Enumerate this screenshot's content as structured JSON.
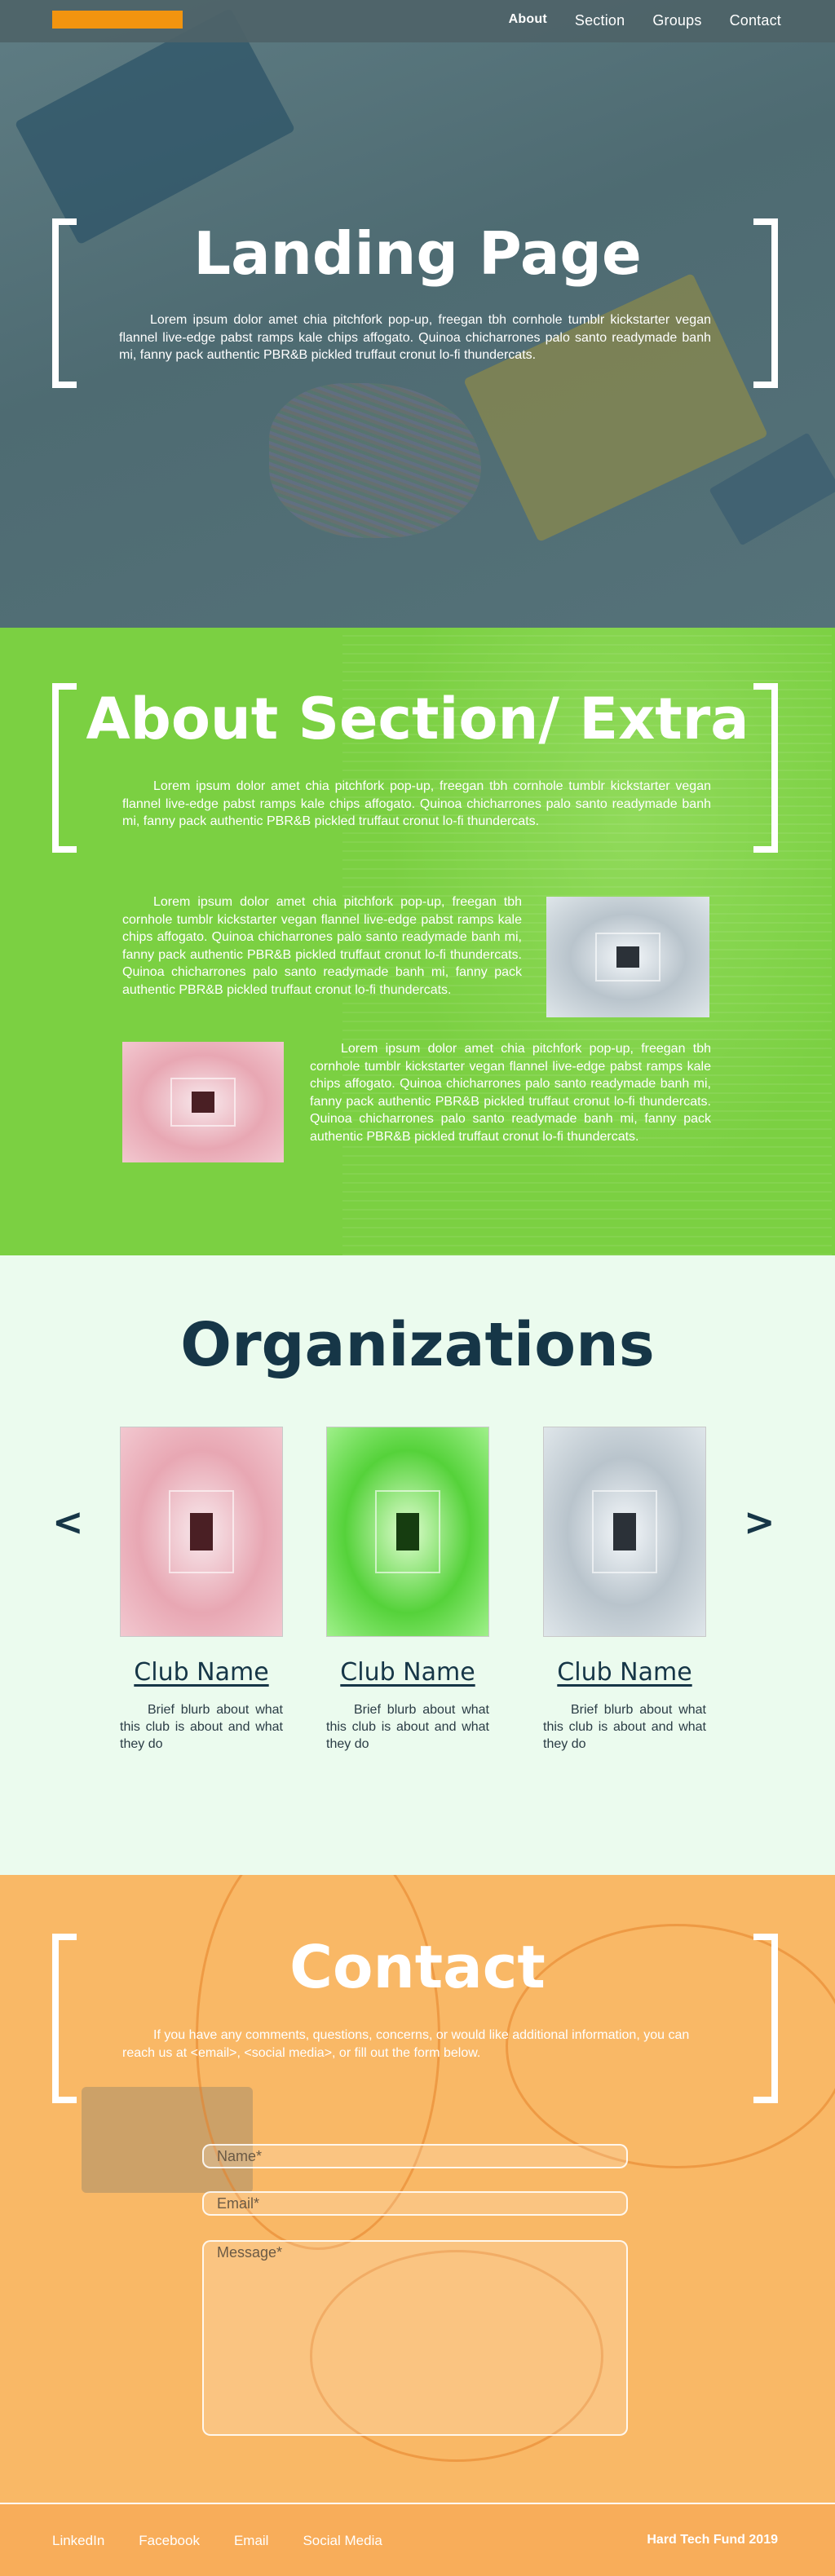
{
  "nav": {
    "links": [
      "About",
      "Section",
      "Groups",
      "Contact"
    ],
    "active": "About",
    "accent_color": "#f2940f"
  },
  "hero": {
    "title": "Landing Page",
    "text": "Lorem ipsum dolor amet chia pitchfork pop-up, freegan tbh cornhole tumblr kickstarter vegan flannel live-edge pabst ramps kale chips affogato. Quinoa chicharrones palo santo readymade banh mi, fanny pack authentic PBR&B pickled truffaut cronut lo-fi thundercats."
  },
  "about": {
    "title": "About Section/ Extra",
    "intro": "Lorem ipsum dolor amet chia pitchfork pop-up, freegan tbh cornhole tumblr kickstarter vegan flannel live-edge pabst ramps kale chips affogato. Quinoa chicharrones palo santo readymade banh mi, fanny pack authentic PBR&B pickled truffaut cronut lo-fi thundercats.",
    "block1": "Lorem ipsum dolor amet chia pitchfork pop-up, freegan tbh cornhole tumblr kickstarter vegan flannel live-edge pabst ramps kale chips affogato. Quinoa chicharrones palo santo readymade banh mi, fanny pack authentic PBR&B pickled truffaut cronut lo-fi thundercats. Quinoa chicharrones palo santo readymade banh mi, fanny pack authentic PBR&B pickled truffaut cronut lo-fi thundercats.",
    "block2": "Lorem ipsum dolor amet chia pitchfork pop-up, freegan tbh cornhole tumblr kickstarter vegan flannel live-edge pabst ramps kale chips affogato. Quinoa chicharrones palo santo readymade banh mi, fanny pack authentic PBR&B pickled truffaut cronut lo-fi thundercats. Quinoa chicharrones palo santo readymade banh mi, fanny pack authentic PBR&B pickled truffaut cronut lo-fi thundercats.",
    "bg_color": "#7bd042"
  },
  "organizations": {
    "title": "Organizations",
    "prev_label": "<",
    "next_label": ">",
    "clubs": [
      {
        "name": "Club Name",
        "blurb": "Brief blurb about what this club is about and what they do",
        "image": "pink-corridor"
      },
      {
        "name": "Club Name",
        "blurb": "Brief blurb about what this club is about and what they do",
        "image": "green-corridor"
      },
      {
        "name": "Club Name",
        "blurb": "Brief blurb about what this club is about and what they do",
        "image": "grey-corridor"
      }
    ]
  },
  "contact": {
    "title": "Contact",
    "text": "If you have any comments, questions, concerns, or would like additional information, you can reach us at <email>, <social media>, or fill out the form below.",
    "name_placeholder": "Name*",
    "email_placeholder": "Email*",
    "message_placeholder": "Message*",
    "bg_color": "#f9b866"
  },
  "footer": {
    "links": [
      "LinkedIn",
      "Facebook",
      "Email",
      "Social Media"
    ],
    "credit": "Hard Tech Fund 2019"
  }
}
